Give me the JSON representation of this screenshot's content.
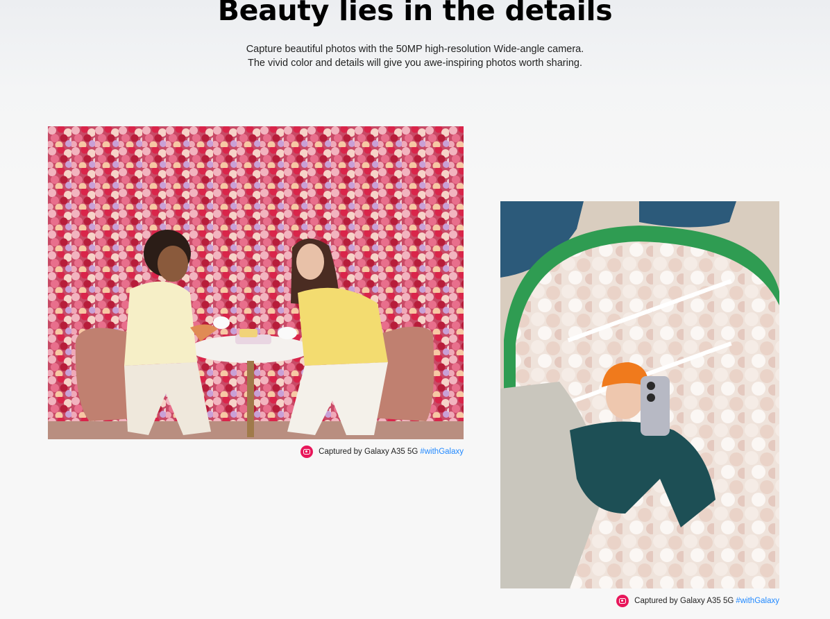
{
  "section": {
    "headline": "Beauty lies in the details",
    "description": "Capture beautiful photos with the 50MP high-resolution Wide-angle camera. The vivid color and details will give you awe-inspiring photos worth sharing."
  },
  "gallery": [
    {
      "caption": "Captured by Galaxy A35 5G",
      "hashtag": "#withGalaxy",
      "icon": "camera-icon"
    },
    {
      "caption": "Captured by Galaxy A35 5G",
      "hashtag": "#withGalaxy",
      "icon": "camera-icon"
    }
  ],
  "colors": {
    "icon_badge": "#e8165a",
    "hashtag": "#2189ff",
    "text": "#222222"
  }
}
